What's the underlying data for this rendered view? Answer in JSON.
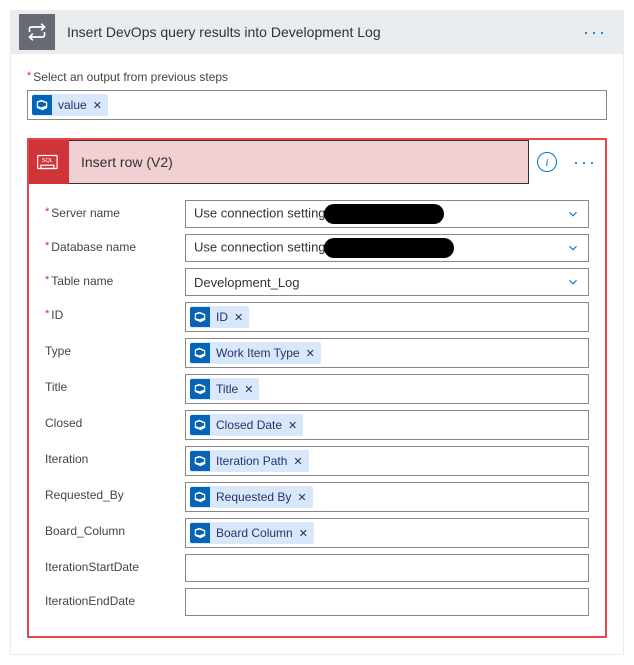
{
  "foreach": {
    "title": "Insert DevOps query results into Development Log",
    "output_label": "Select an output from previous steps",
    "output_token": "value"
  },
  "action": {
    "title": "Insert row (V2)",
    "fields": {
      "server": {
        "label": "Server name",
        "value": "Use connection setting"
      },
      "database": {
        "label": "Database name",
        "value": "Use connection setting"
      },
      "table": {
        "label": "Table name",
        "value": "Development_Log"
      },
      "id": {
        "label": "ID",
        "token": "ID"
      },
      "type": {
        "label": "Type",
        "token": "Work Item Type"
      },
      "title_f": {
        "label": "Title",
        "token": "Title"
      },
      "closed": {
        "label": "Closed",
        "token": "Closed Date"
      },
      "iteration": {
        "label": "Iteration",
        "token": "Iteration Path"
      },
      "requested": {
        "label": "Requested_By",
        "token": "Requested By"
      },
      "board": {
        "label": "Board_Column",
        "token": "Board Column"
      },
      "iter_start": {
        "label": "IterationStartDate"
      },
      "iter_end": {
        "label": "IterationEndDate"
      }
    }
  }
}
